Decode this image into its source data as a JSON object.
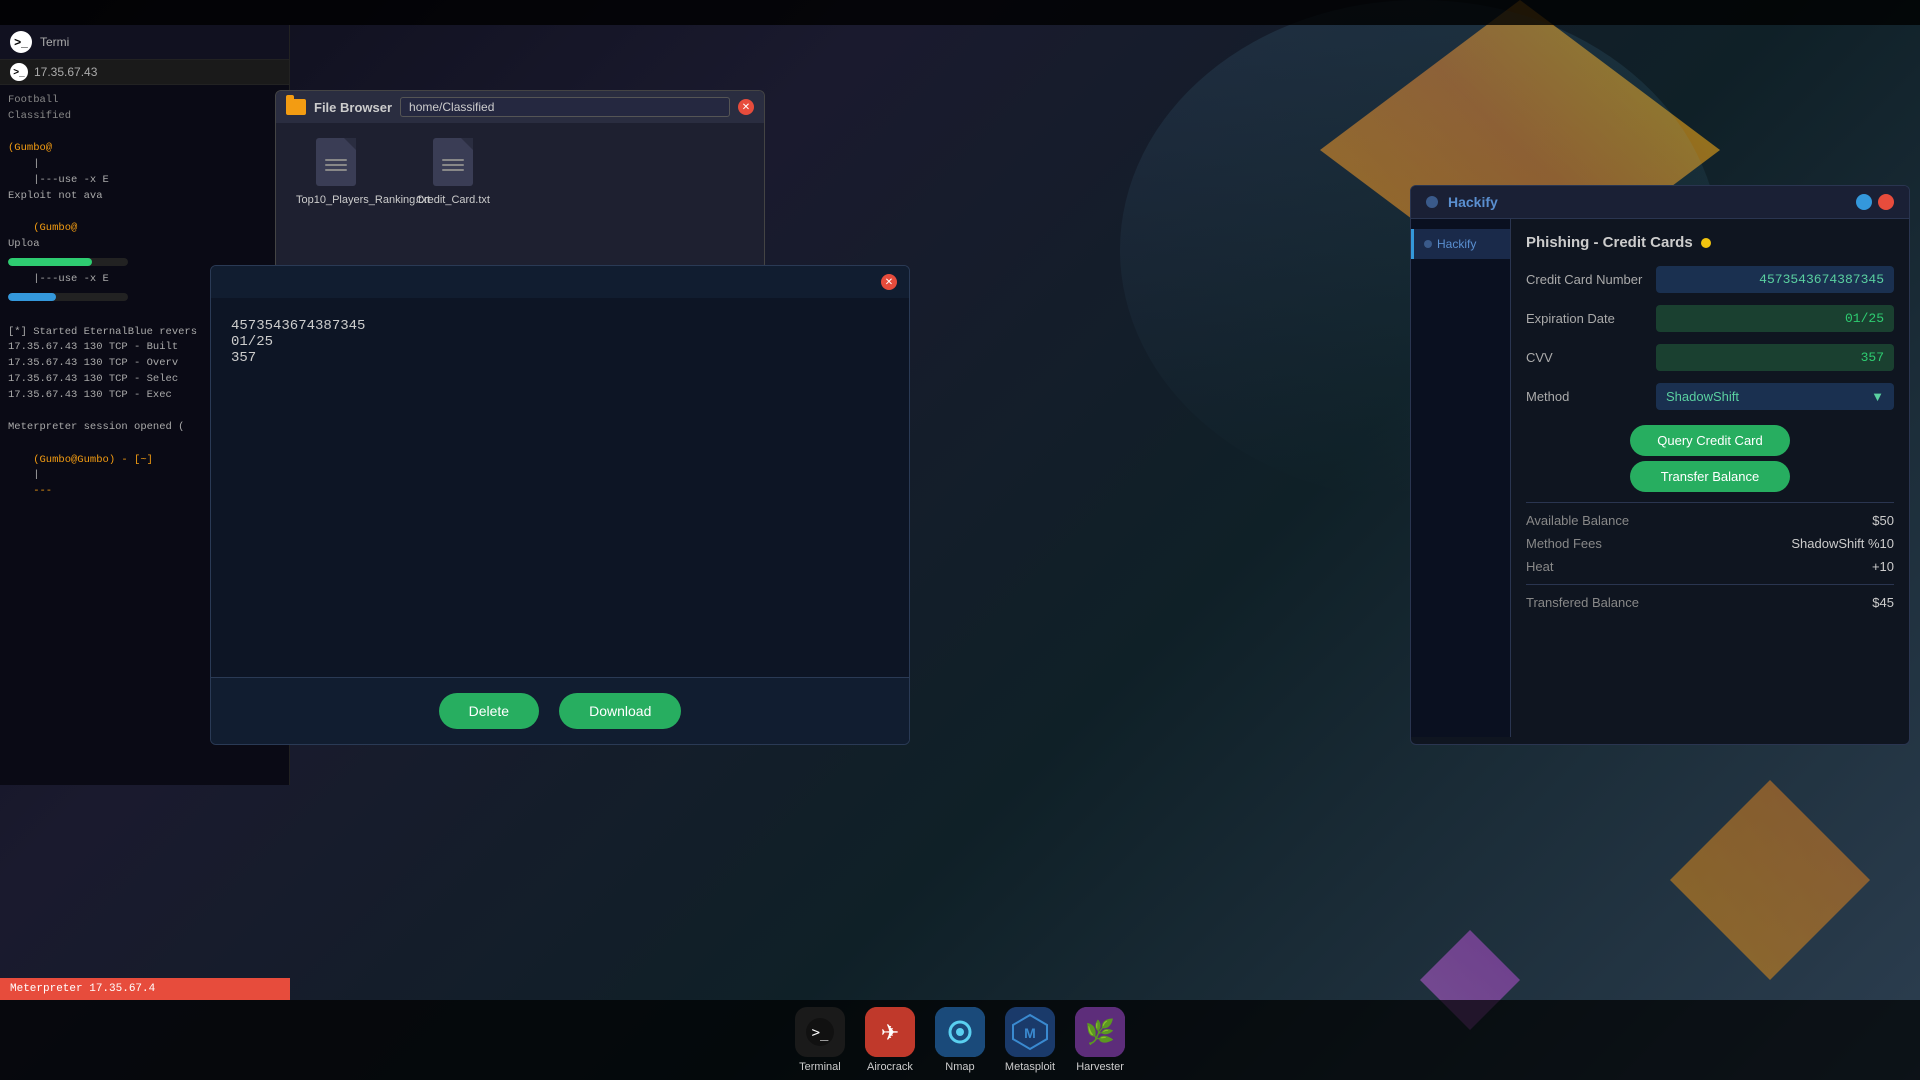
{
  "desktop": {
    "taskbar_top": ""
  },
  "terminal": {
    "title": "Termi",
    "ip": "17.35.67.43",
    "lines": [
      {
        "text": "(Gumbo@",
        "class": "t-yellow"
      },
      {
        "text": "    |",
        "class": ""
      },
      {
        "text": "    |---use -x E",
        "class": ""
      },
      {
        "text": "Exploit not ava",
        "class": ""
      },
      {
        "text": "    (Gumbo@",
        "class": "t-yellow"
      },
      {
        "text": "    |---use -x E",
        "class": ""
      },
      {
        "text": "[*] Started EternalBlue revers",
        "class": ""
      },
      {
        "text": "17.35.67.43 130 TCP - Built",
        "class": ""
      },
      {
        "text": "17.35.67.43 130 TCP - Overv",
        "class": ""
      },
      {
        "text": "17.35.67.43 130 TCP - Selec",
        "class": ""
      },
      {
        "text": "17.35.67.43 130 TCP - Exec",
        "class": ""
      },
      {
        "text": "",
        "class": ""
      },
      {
        "text": "Meterpreter session opened (",
        "class": ""
      },
      {
        "text": "",
        "class": ""
      },
      {
        "text": "(Gumbo@Gumbo) - [~]",
        "class": "t-yellow"
      },
      {
        "text": "|",
        "class": ""
      },
      {
        "text": "---",
        "class": "t-yellow"
      }
    ],
    "upload_label": "Uploa",
    "meterpreter_text": "Meterpreter 17.35.67.4"
  },
  "sidebar": {
    "items": [
      {
        "label": "Football",
        "icon": "folder"
      },
      {
        "label": "Classified",
        "icon": "folder"
      }
    ]
  },
  "file_browser": {
    "title": "File Browser",
    "path": "home/Classified",
    "files": [
      {
        "name": "Top10_Players_Ranking.txt",
        "icon": "document"
      },
      {
        "name": "Credit_Card.txt",
        "icon": "document"
      }
    ]
  },
  "hackify": {
    "title": "Hackify",
    "sidebar_items": [
      {
        "label": "Hackify",
        "active": true
      }
    ],
    "panel_title": "Phishing - Credit Cards",
    "status": "yellow",
    "fields": {
      "credit_card_label": "Credit Card Number",
      "credit_card_value": "4573543674387345",
      "expiration_label": "Expiration Date",
      "expiration_value": "01/25",
      "cvv_label": "CVV",
      "cvv_value": "357",
      "method_label": "Method",
      "method_value": "ShadowShift"
    },
    "buttons": {
      "query": "Query Credit Card",
      "transfer": "Transfer Balance"
    },
    "info": {
      "available_balance_label": "Available Balance",
      "available_balance_value": "$50",
      "method_fees_label": "Method Fees",
      "method_fees_value": "ShadowShift %10",
      "heat_label": "Heat",
      "heat_value": "+10",
      "transferred_balance_label": "Transfered Balance",
      "transferred_balance_value": "$45"
    }
  },
  "file_dialog": {
    "content_lines": [
      "4573543674387345",
      "01/25",
      "357"
    ],
    "buttons": {
      "delete": "Delete",
      "download": "Download"
    }
  },
  "taskbar": {
    "apps": [
      {
        "label": "Terminal",
        "icon": ">_"
      },
      {
        "label": "Airocrack",
        "icon": "✈"
      },
      {
        "label": "Nmap",
        "icon": "👁"
      },
      {
        "label": "Metasploit",
        "icon": "M"
      },
      {
        "label": "Harvester",
        "icon": "🌿"
      }
    ]
  }
}
